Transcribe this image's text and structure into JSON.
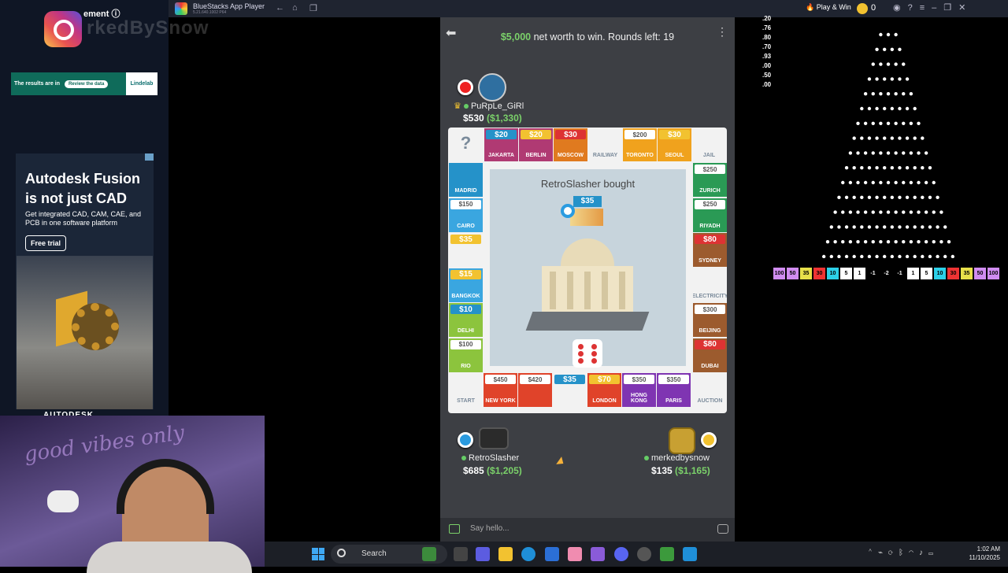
{
  "overlay": {
    "ig_text": "ement ⓘ",
    "handle": "rkedBySnow",
    "banner1": {
      "text": "The results are in",
      "button": "Review the data",
      "logo": "Lindelab"
    },
    "ad": {
      "title": "Autodesk Fusion is not just CAD",
      "subtitle": "Get integrated CAD, CAM, CAE, and PCB in one software platform",
      "cta": "Free trial",
      "footer": "AUTODESK"
    },
    "webcam_text": "good vibes only"
  },
  "bluestacks": {
    "title": "BlueStacks App Player",
    "version": "5.21.640.1002  P64",
    "play_win": "Play & Win",
    "coins": "0"
  },
  "game": {
    "goal_amount": "$5,000",
    "goal_text": " net worth to win. Rounds left: 19",
    "players": [
      {
        "name": "PuRpLe_GiRl",
        "cash": "$530",
        "networth": "($1,330)",
        "token_color": "#e22"
      },
      {
        "name": "RetroSlasher",
        "cash": "$685",
        "networth": "($1,205)",
        "token_color": "#2a9be0"
      },
      {
        "name": "merkedbysnow",
        "cash": "$135",
        "networth": "($1,165)",
        "token_color": "#f2c230"
      }
    ],
    "center_title": "RetroSlasher bought",
    "bought_price": "$35",
    "top_row": [
      {
        "name": "?",
        "price": "",
        "color": "#f2f2f2"
      },
      {
        "name": "JAKARTA",
        "price": "$20",
        "color": "#b03a73",
        "owned": "#2592c9"
      },
      {
        "name": "BERLIN",
        "price": "$20",
        "color": "#b03a73",
        "owned": "#f2c230"
      },
      {
        "name": "MOSCOW",
        "price": "$30",
        "color": "#e07a1f",
        "owned": "#d33"
      },
      {
        "name": "RAILWAY",
        "price": "",
        "color": "#f2f2f2"
      },
      {
        "name": "TORONTO",
        "price": "$200",
        "color": "#f0a21d"
      },
      {
        "name": "SEOUL",
        "price": "$30",
        "color": "#f0a21d",
        "owned": "#f2c230"
      },
      {
        "name": "JAIL",
        "price": "",
        "color": "#f2f2f2"
      }
    ],
    "left_col": [
      {
        "name": "MADRID",
        "price": "",
        "color": "#2592c9"
      },
      {
        "name": "CAIRO",
        "price": "$150",
        "color": "#3aa6e0"
      },
      {
        "name": "",
        "price": "$35",
        "color": "#f2f2f2",
        "owned": "#f2c230"
      },
      {
        "name": "BANGKOK",
        "price": "$15",
        "color": "#3aa6e0",
        "owned": "#f2c230"
      },
      {
        "name": "DELHI",
        "price": "$10",
        "color": "#8cc43d",
        "owned": "#2592c9"
      },
      {
        "name": "RIO",
        "price": "$100",
        "color": "#8cc43d"
      },
      {
        "name": "START",
        "price": "",
        "color": "#f2f2f2"
      }
    ],
    "right_col": [
      {
        "name": "ZURICH",
        "price": "$250",
        "color": "#2a9a55"
      },
      {
        "name": "RIYADH",
        "price": "$250",
        "color": "#2a9a55"
      },
      {
        "name": "SYDNEY",
        "price": "$80",
        "color": "#9c5b2e",
        "owned": "#d33"
      },
      {
        "name": "ELECTRICITY",
        "price": "",
        "color": "#f2f2f2"
      },
      {
        "name": "BEIJING",
        "price": "$300",
        "color": "#9c5b2e"
      },
      {
        "name": "DUBAI",
        "price": "$80",
        "color": "#9c5b2e",
        "owned": "#d33"
      },
      {
        "name": "AUCTION",
        "price": "",
        "color": "#f2f2f2"
      }
    ],
    "bottom_row": [
      {
        "name": "NEW YORK",
        "price": "$450",
        "color": "#e0432a"
      },
      {
        "name": "",
        "price": "$420",
        "color": "#e0432a"
      },
      {
        "name": "",
        "price": "$35",
        "color": "#f2f2f2",
        "owned": "#2592c9"
      },
      {
        "name": "LONDON",
        "price": "$70",
        "color": "#e0432a",
        "owned": "#f2c230"
      },
      {
        "name": "HONG KONG",
        "price": "$350",
        "color": "#7f35b2"
      },
      {
        "name": "PARIS",
        "price": "$350",
        "color": "#7f35b2"
      }
    ],
    "chat_placeholder": "Say hello..."
  },
  "plinko": {
    "scale": [
      ".20",
      ".76",
      ".80",
      ".70",
      ".93",
      ".00",
      ".50",
      ".00"
    ],
    "slots": [
      {
        "v": "100",
        "c": "#d08cf0"
      },
      {
        "v": "50",
        "c": "#d08cf0"
      },
      {
        "v": "35",
        "c": "#e8e04a"
      },
      {
        "v": "30",
        "c": "#e33"
      },
      {
        "v": "10",
        "c": "#2cd0e8"
      },
      {
        "v": "5",
        "c": "#fff"
      },
      {
        "v": "1",
        "c": "#fff"
      },
      {
        "v": "-1",
        "c": "#000"
      },
      {
        "v": "-2",
        "c": "#000"
      },
      {
        "v": "-1",
        "c": "#000"
      },
      {
        "v": "1",
        "c": "#fff"
      },
      {
        "v": "5",
        "c": "#fff"
      },
      {
        "v": "10",
        "c": "#2cd0e8"
      },
      {
        "v": "30",
        "c": "#e33"
      },
      {
        "v": "35",
        "c": "#e8e04a"
      },
      {
        "v": "50",
        "c": "#d08cf0"
      },
      {
        "v": "100",
        "c": "#d08cf0"
      }
    ]
  },
  "taskbar": {
    "search": "Search",
    "time": "1:02 AM",
    "date": "11/10/2025"
  }
}
